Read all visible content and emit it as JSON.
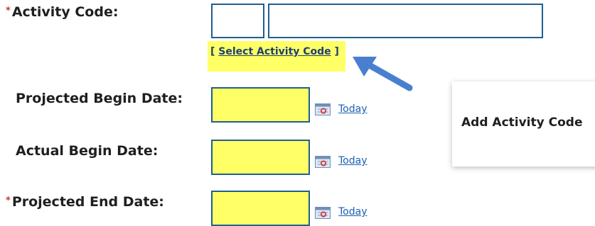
{
  "form": {
    "required_marker": "*",
    "activity_code": {
      "label": "Activity Code:",
      "code_value": "",
      "description_value": ""
    },
    "select_activity_code": {
      "open_bracket": "[",
      "label": "Select Activity Code",
      "close_bracket": "]"
    },
    "projected_begin_date": {
      "label": "Projected Begin Date:",
      "value": "",
      "today_link": "Today"
    },
    "actual_begin_date": {
      "label": "Actual Begin Date:",
      "value": "",
      "today_link": "Today"
    },
    "projected_end_date": {
      "label": "Projected End Date:",
      "value": "",
      "today_link": "Today"
    }
  },
  "tooltip": {
    "text": "Add Activity Code"
  },
  "icons": [
    "calendar-icon",
    "arrow-pointer-icon"
  ],
  "colors": {
    "highlight": "#ffff66",
    "input_border": "#1f5f8f",
    "link": "#1a5fb4",
    "required": "#c0392b",
    "arrow": "#4a7fd0"
  }
}
